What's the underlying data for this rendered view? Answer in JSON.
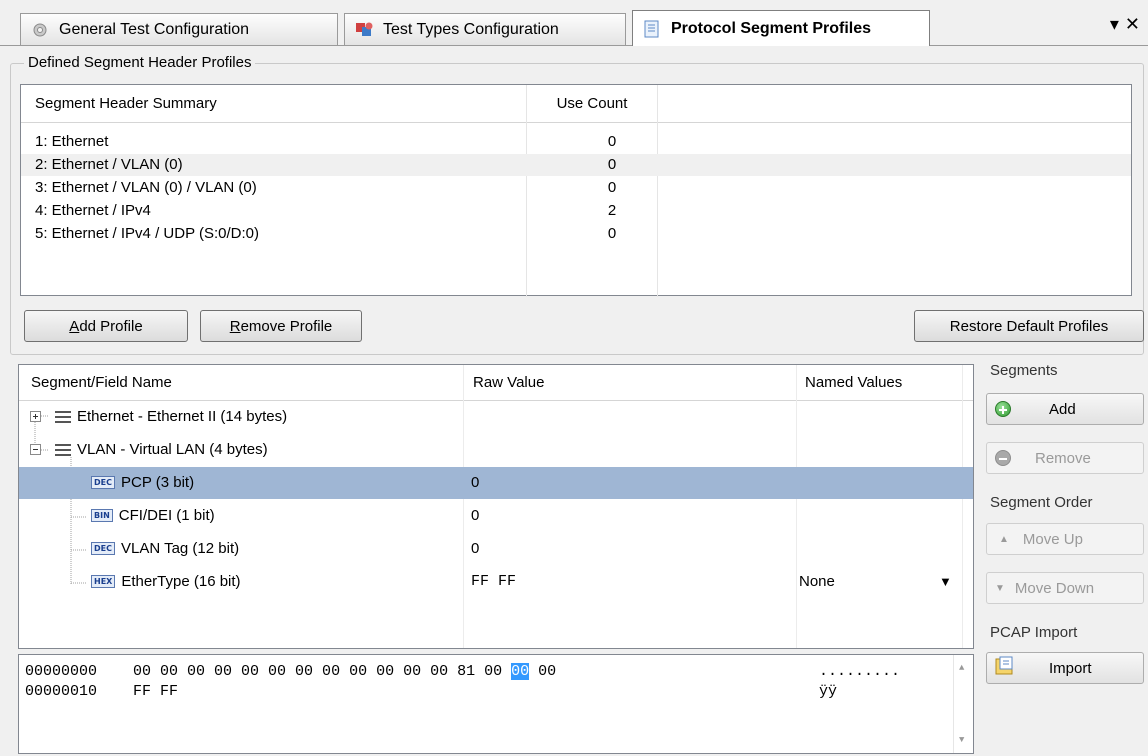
{
  "tabs": [
    {
      "label": "General Test Configuration",
      "icon": "gear-icon"
    },
    {
      "label": "Test Types Configuration",
      "icon": "test-types-icon"
    },
    {
      "label": "Protocol Segment Profiles",
      "icon": "document-icon"
    }
  ],
  "window_controls": {
    "pin": "▾",
    "close": "✕"
  },
  "profiles": {
    "group_title": "Defined Segment Header Profiles",
    "columns": [
      "Segment Header Summary",
      "Use Count"
    ],
    "rows": [
      {
        "summary": "1: Ethernet",
        "count": "0"
      },
      {
        "summary": "2: Ethernet / VLAN (0)",
        "count": "0"
      },
      {
        "summary": "3: Ethernet / VLAN (0) / VLAN (0)",
        "count": "0"
      },
      {
        "summary": "4: Ethernet / IPv4",
        "count": "2"
      },
      {
        "summary": "5: Ethernet / IPv4 / UDP (S:0/D:0)",
        "count": "0"
      }
    ],
    "add_button": {
      "accel": "A",
      "rest": "dd Profile"
    },
    "remove_button": {
      "accel": "R",
      "rest": "emove Profile"
    },
    "restore_button": "Restore Default Profiles"
  },
  "fields": {
    "columns": [
      "Segment/Field Name",
      "Raw Value",
      "Named Values"
    ],
    "segments": [
      {
        "label": "Ethernet - Ethernet II (14 bytes)",
        "expanded": false
      },
      {
        "label": "VLAN - Virtual LAN (4 bytes)",
        "expanded": true
      }
    ],
    "rows": [
      {
        "badge": "DEC",
        "name": "PCP (3 bit)",
        "raw": "0",
        "named": ""
      },
      {
        "badge": "BIN",
        "name": "CFI/DEI (1 bit)",
        "raw": "0",
        "named": ""
      },
      {
        "badge": "DEC",
        "name": "VLAN Tag (12 bit)",
        "raw": "0",
        "named": ""
      },
      {
        "badge": "HEX",
        "name": "EtherType (16 bit)",
        "raw": "FF FF",
        "named": "None"
      }
    ]
  },
  "hex": {
    "lines": [
      {
        "offset": "00000000",
        "bytes_before": "00 00 00 00 00 00 00 00 00 00 00 00 81 00 ",
        "bytes_sel": "00",
        "bytes_after": " 00",
        "ascii": "........."
      },
      {
        "offset": "00000010",
        "bytes_before": "FF FF",
        "bytes_sel": "",
        "bytes_after": "",
        "ascii": "ÿÿ"
      }
    ]
  },
  "side": {
    "segments_label": "Segments",
    "add": "Add",
    "remove": "Remove",
    "order_label": "Segment Order",
    "move_up": "Move Up",
    "move_down": "Move Down",
    "pcap_label": "PCAP Import",
    "import": "Import"
  }
}
